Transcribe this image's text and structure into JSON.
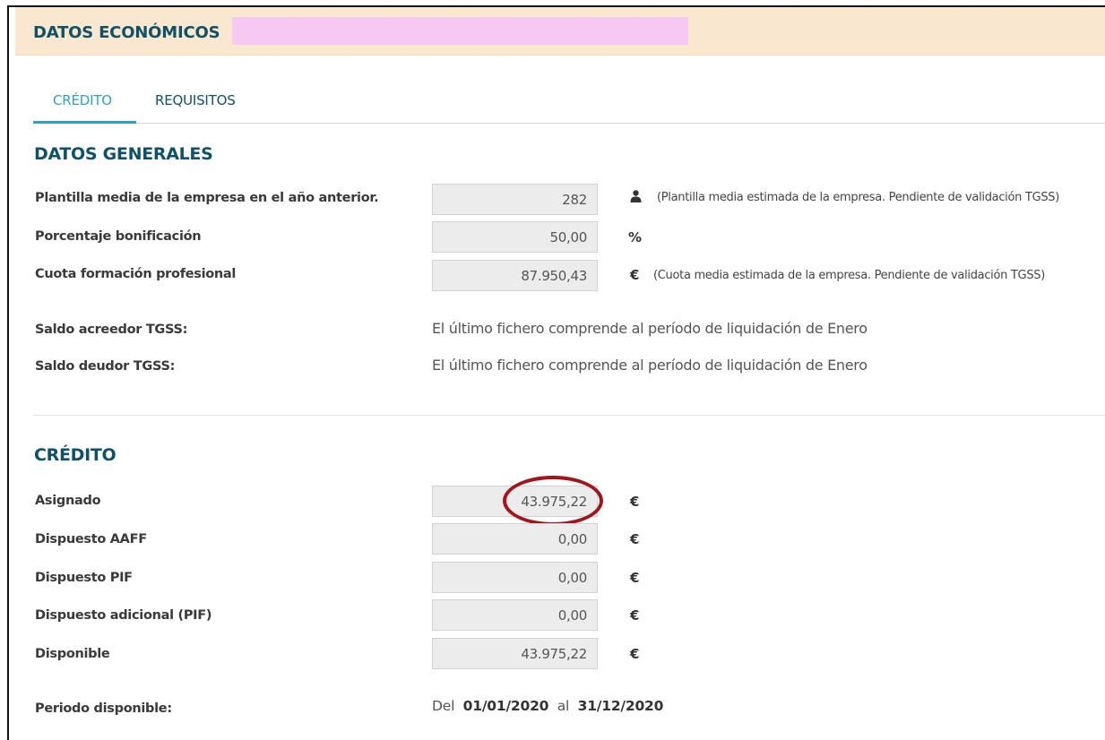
{
  "header": {
    "title": "DATOS ECONÓMICOS"
  },
  "tabs": [
    {
      "label": "CRÉDITO",
      "active": true
    },
    {
      "label": "REQUISITOS",
      "active": false
    }
  ],
  "general": {
    "title": "DATOS GENERALES",
    "plantilla": {
      "label": "Plantilla media de la empresa en el año anterior.",
      "value": "282",
      "icon": "person-icon",
      "note": "(Plantilla media estimada de la empresa. Pendiente de validación TGSS)"
    },
    "porcentaje": {
      "label": "Porcentaje bonificación",
      "value": "50,00",
      "unit": "%"
    },
    "cuota": {
      "label": "Cuota formación profesional",
      "value": "87.950,43",
      "unit": "€",
      "note": "(Cuota media estimada de la empresa. Pendiente de validación TGSS)"
    },
    "saldo_acreedor": {
      "label": "Saldo acreedor TGSS:",
      "text": "El último fichero comprende al período de liquidación de Enero"
    },
    "saldo_deudor": {
      "label": "Saldo deudor TGSS:",
      "text": "El último fichero comprende al período de liquidación de Enero"
    }
  },
  "credito": {
    "title": "CRÉDITO",
    "rows": [
      {
        "label": "Asignado",
        "value": "43.975,22",
        "unit": "€"
      },
      {
        "label": "Dispuesto AAFF",
        "value": "0,00",
        "unit": "€"
      },
      {
        "label": "Dispuesto PIF",
        "value": "0,00",
        "unit": "€"
      },
      {
        "label": "Dispuesto adicional (PIF)",
        "value": "0,00",
        "unit": "€"
      },
      {
        "label": "Disponible",
        "value": "43.975,22",
        "unit": "€"
      }
    ],
    "periodo": {
      "label": "Periodo disponible:",
      "del": "Del",
      "start": "01/01/2020",
      "al": "al",
      "end": "31/12/2020"
    }
  },
  "colors": {
    "accent": "#2da3c4",
    "title": "#0f5168",
    "header_bg": "#fae7cf",
    "highlight": "#a3141b"
  }
}
